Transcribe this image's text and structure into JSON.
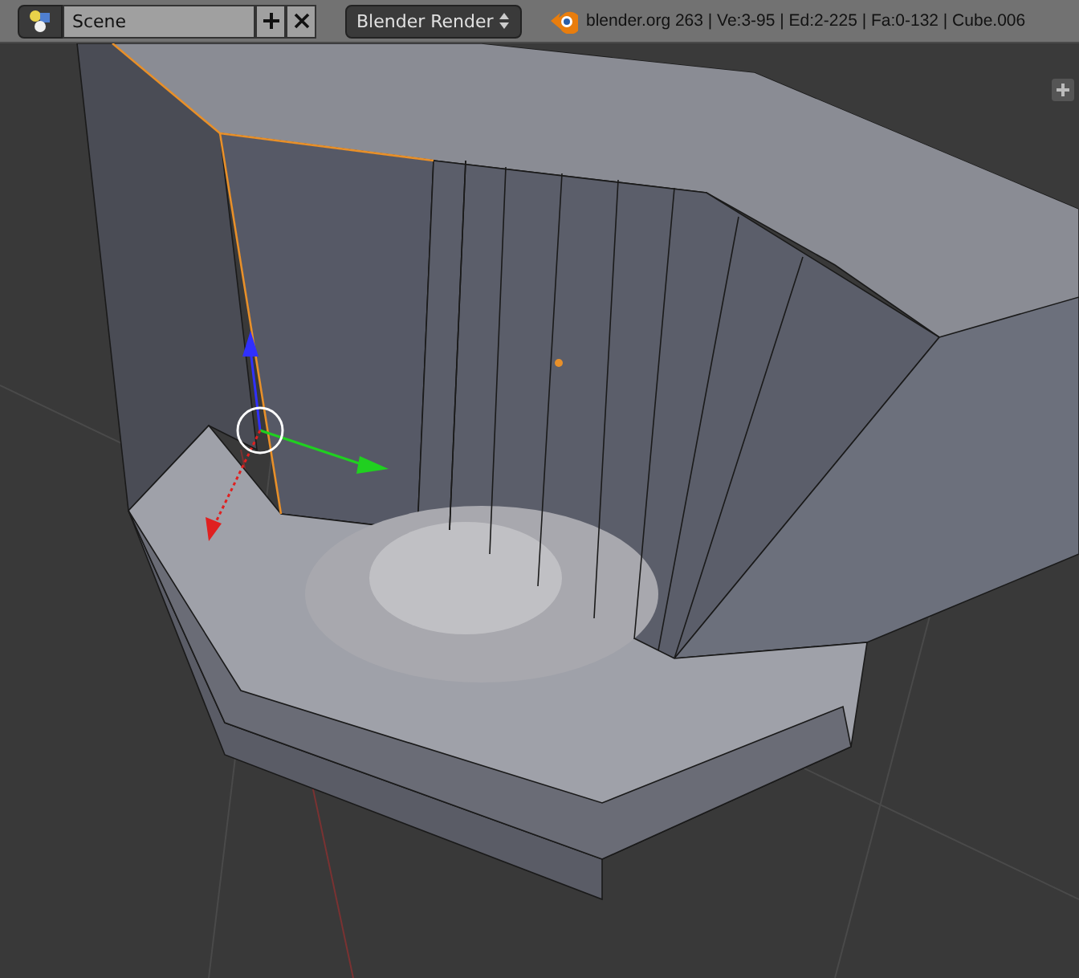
{
  "header": {
    "scene_field": {
      "value": "Scene"
    },
    "render_engine": "Blender Render",
    "info": "blender.org 263 | Ve:3-95 | Ed:2-225 | Fa:0-132 | Cube.006"
  }
}
